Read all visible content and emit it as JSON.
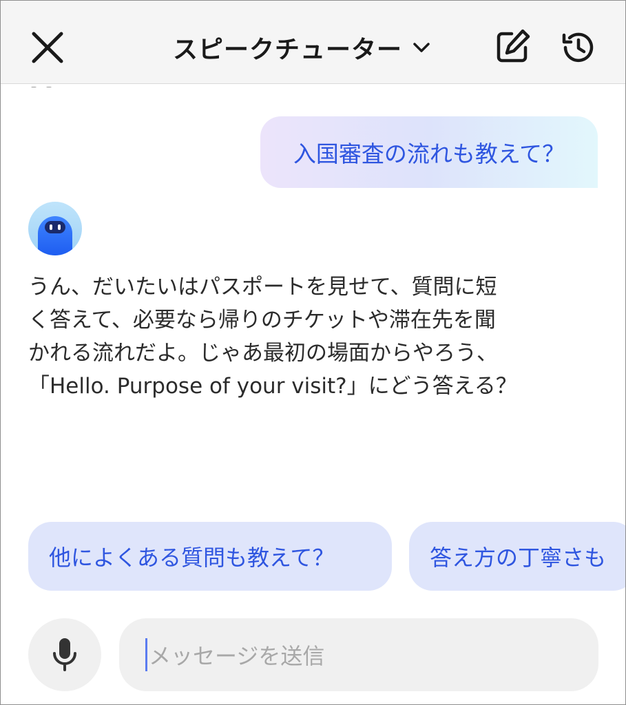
{
  "header": {
    "close_icon": "close-icon",
    "title": "スピークチューター",
    "title_dropdown_icon": "chevron-down-icon",
    "edit_icon": "edit-icon",
    "history_icon": "history-icon"
  },
  "chat": {
    "user_message": "入国審査の流れも教えて？",
    "assistant_avatar_icon": "robot-avatar",
    "assistant_lines": [
      "うん、だいたいはパスポートを見せて、質問に短",
      "く答えて、必要なら帰りのチケットや滞在先を聞",
      "かれる流れだよ。じゃあ最初の場面からやろう、",
      "「Hello. Purpose of your visit?」にどう答える？"
    ]
  },
  "suggestions": [
    "他によくある質問も教えて？",
    "答え方の丁寧さも"
  ],
  "composer": {
    "mic_icon": "microphone-icon",
    "placeholder": "メッセージを送信"
  },
  "colors": {
    "accent": "#2f56e0",
    "chip_bg": "#dfe5fb",
    "header_bg": "#f5f5f5",
    "input_bg": "#f0f0f0"
  }
}
